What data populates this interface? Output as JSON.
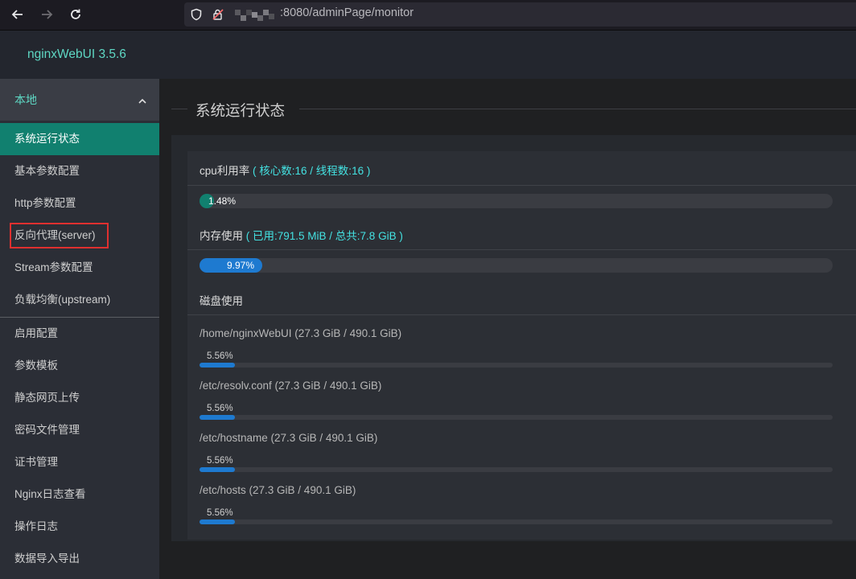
{
  "browser": {
    "url_suffix": ":8080/adminPage/monitor"
  },
  "app": {
    "title": "nginxWebUI 3.5.6"
  },
  "sidebar": {
    "group_title": "本地",
    "items": [
      {
        "label": "系统运行状态"
      },
      {
        "label": "基本参数配置"
      },
      {
        "label": "http参数配置"
      },
      {
        "label": "反向代理(server)"
      },
      {
        "label": "Stream参数配置"
      },
      {
        "label": "负载均衡(upstream)"
      },
      {
        "label": "启用配置"
      },
      {
        "label": "参数模板"
      },
      {
        "label": "静态网页上传"
      },
      {
        "label": "密码文件管理"
      },
      {
        "label": "证书管理"
      },
      {
        "label": "Nginx日志查看"
      },
      {
        "label": "操作日志"
      },
      {
        "label": "数据导入导出"
      }
    ]
  },
  "main": {
    "title": "系统运行状态",
    "cpu": {
      "label": "cpu利用率",
      "detail": "( 核心数:16 / 线程数:16 )",
      "percent_text": "1.48%",
      "fraction": 0.0148,
      "color": "#11806f"
    },
    "memory": {
      "label": "内存使用",
      "detail": "( 已用:791.5 MiB / 总共:7.8 GiB )",
      "percent_text": "9.97%",
      "fraction": 0.0997,
      "color": "#1e7ad0"
    },
    "disk": {
      "label": "磁盘使用",
      "items": [
        {
          "name": "/home/nginxWebUI (27.3 GiB / 490.1 GiB)",
          "percent_text": "5.56%",
          "fraction": 0.0556
        },
        {
          "name": "/etc/resolv.conf (27.3 GiB / 490.1 GiB)",
          "percent_text": "5.56%",
          "fraction": 0.0556
        },
        {
          "name": "/etc/hostname (27.3 GiB / 490.1 GiB)",
          "percent_text": "5.56%",
          "fraction": 0.0556
        },
        {
          "name": "/etc/hosts (27.3 GiB / 490.1 GiB)",
          "percent_text": "5.56%",
          "fraction": 0.0556
        }
      ]
    }
  }
}
